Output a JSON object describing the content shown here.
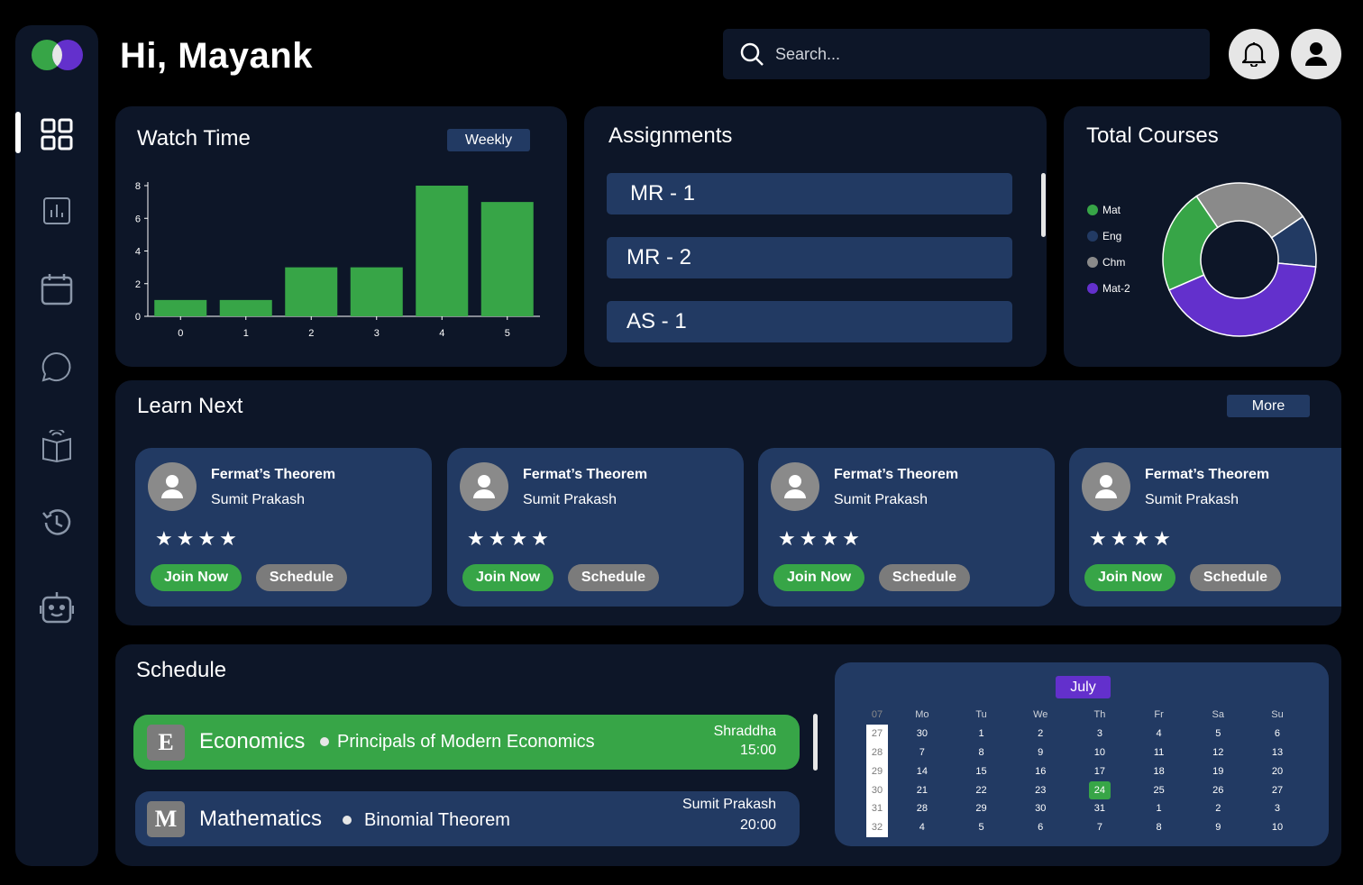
{
  "greeting": "Hi, Mayank",
  "search": {
    "placeholder": "Search..."
  },
  "sidebar": {
    "items": [
      {
        "icon": "dashboard-icon",
        "active": true
      },
      {
        "icon": "chart-icon"
      },
      {
        "icon": "calendar-icon"
      },
      {
        "icon": "chat-icon"
      },
      {
        "icon": "book-icon"
      },
      {
        "icon": "history-icon"
      },
      {
        "icon": "bot-icon"
      }
    ]
  },
  "watch_time": {
    "title": "Watch Time",
    "filter_label": "Weekly",
    "chart_data": {
      "type": "bar",
      "categories": [
        "0",
        "1",
        "2",
        "3",
        "4",
        "5"
      ],
      "values": [
        1,
        1,
        3,
        3,
        8,
        7
      ],
      "yticks": [
        "0",
        "2",
        "4",
        "6",
        "8"
      ],
      "ylim": [
        0,
        8
      ],
      "color": "#37a547"
    }
  },
  "assignments": {
    "title": "Assignments",
    "items": [
      "MR - 1",
      "MR - 2",
      "AS - 1"
    ]
  },
  "total_courses": {
    "title": "Total Courses",
    "chart_data": {
      "type": "pie",
      "donut": true,
      "series": [
        {
          "name": "Mat",
          "value": 22,
          "color": "#37a547"
        },
        {
          "name": "Eng",
          "value": 11,
          "color": "#223a63"
        },
        {
          "name": "Chm",
          "value": 25,
          "color": "#8a8a8a"
        },
        {
          "name": "Mat-2",
          "value": 42,
          "color": "#6330cc"
        }
      ]
    }
  },
  "learn_next": {
    "title": "Learn Next",
    "more_label": "More",
    "cards": [
      {
        "title": "Fermat’s Theorem",
        "teacher": "Sumit Prakash",
        "stars": "★★★★",
        "join_label": "Join Now",
        "schedule_label": "Schedule"
      },
      {
        "title": "Fermat’s Theorem",
        "teacher": "Sumit Prakash",
        "stars": "★★★★",
        "join_label": "Join Now",
        "schedule_label": "Schedule"
      },
      {
        "title": "Fermat’s Theorem",
        "teacher": "Sumit Prakash",
        "stars": "★★★★",
        "join_label": "Join Now",
        "schedule_label": "Schedule"
      },
      {
        "title": "Fermat’s Theorem",
        "teacher": "Sumit Prakash",
        "stars": "★★★★",
        "join_label": "Join Now",
        "schedule_label": "Schedule"
      }
    ]
  },
  "schedule": {
    "title": "Schedule",
    "classes": [
      {
        "badge": "E",
        "subject": "Economics",
        "topic": "Principals of Modern Economics",
        "teacher": "Shraddha",
        "time": "15:00",
        "color": "#37a547"
      },
      {
        "badge": "M",
        "subject": "Mathematics",
        "topic": "Binomial Theorem",
        "teacher": "Sumit Prakash",
        "time": "20:00",
        "color": "#223a63"
      }
    ]
  },
  "calendar": {
    "month": "July",
    "week_header": "07",
    "day_headers": [
      "Mo",
      "Tu",
      "We",
      "Th",
      "Fr",
      "Sa",
      "Su"
    ],
    "weeks": [
      {
        "num": "27",
        "days": [
          "30",
          "1",
          "2",
          "3",
          "4",
          "5",
          "6"
        ]
      },
      {
        "num": "28",
        "days": [
          "7",
          "8",
          "9",
          "10",
          "11",
          "12",
          "13"
        ]
      },
      {
        "num": "29",
        "days": [
          "14",
          "15",
          "16",
          "17",
          "18",
          "19",
          "20"
        ]
      },
      {
        "num": "30",
        "days": [
          "21",
          "22",
          "23",
          "24",
          "25",
          "26",
          "27"
        ]
      },
      {
        "num": "31",
        "days": [
          "28",
          "29",
          "30",
          "31",
          "1",
          "2",
          "3"
        ]
      },
      {
        "num": "32",
        "days": [
          "4",
          "5",
          "6",
          "7",
          "8",
          "9",
          "10"
        ]
      }
    ],
    "selected_day": "24"
  }
}
